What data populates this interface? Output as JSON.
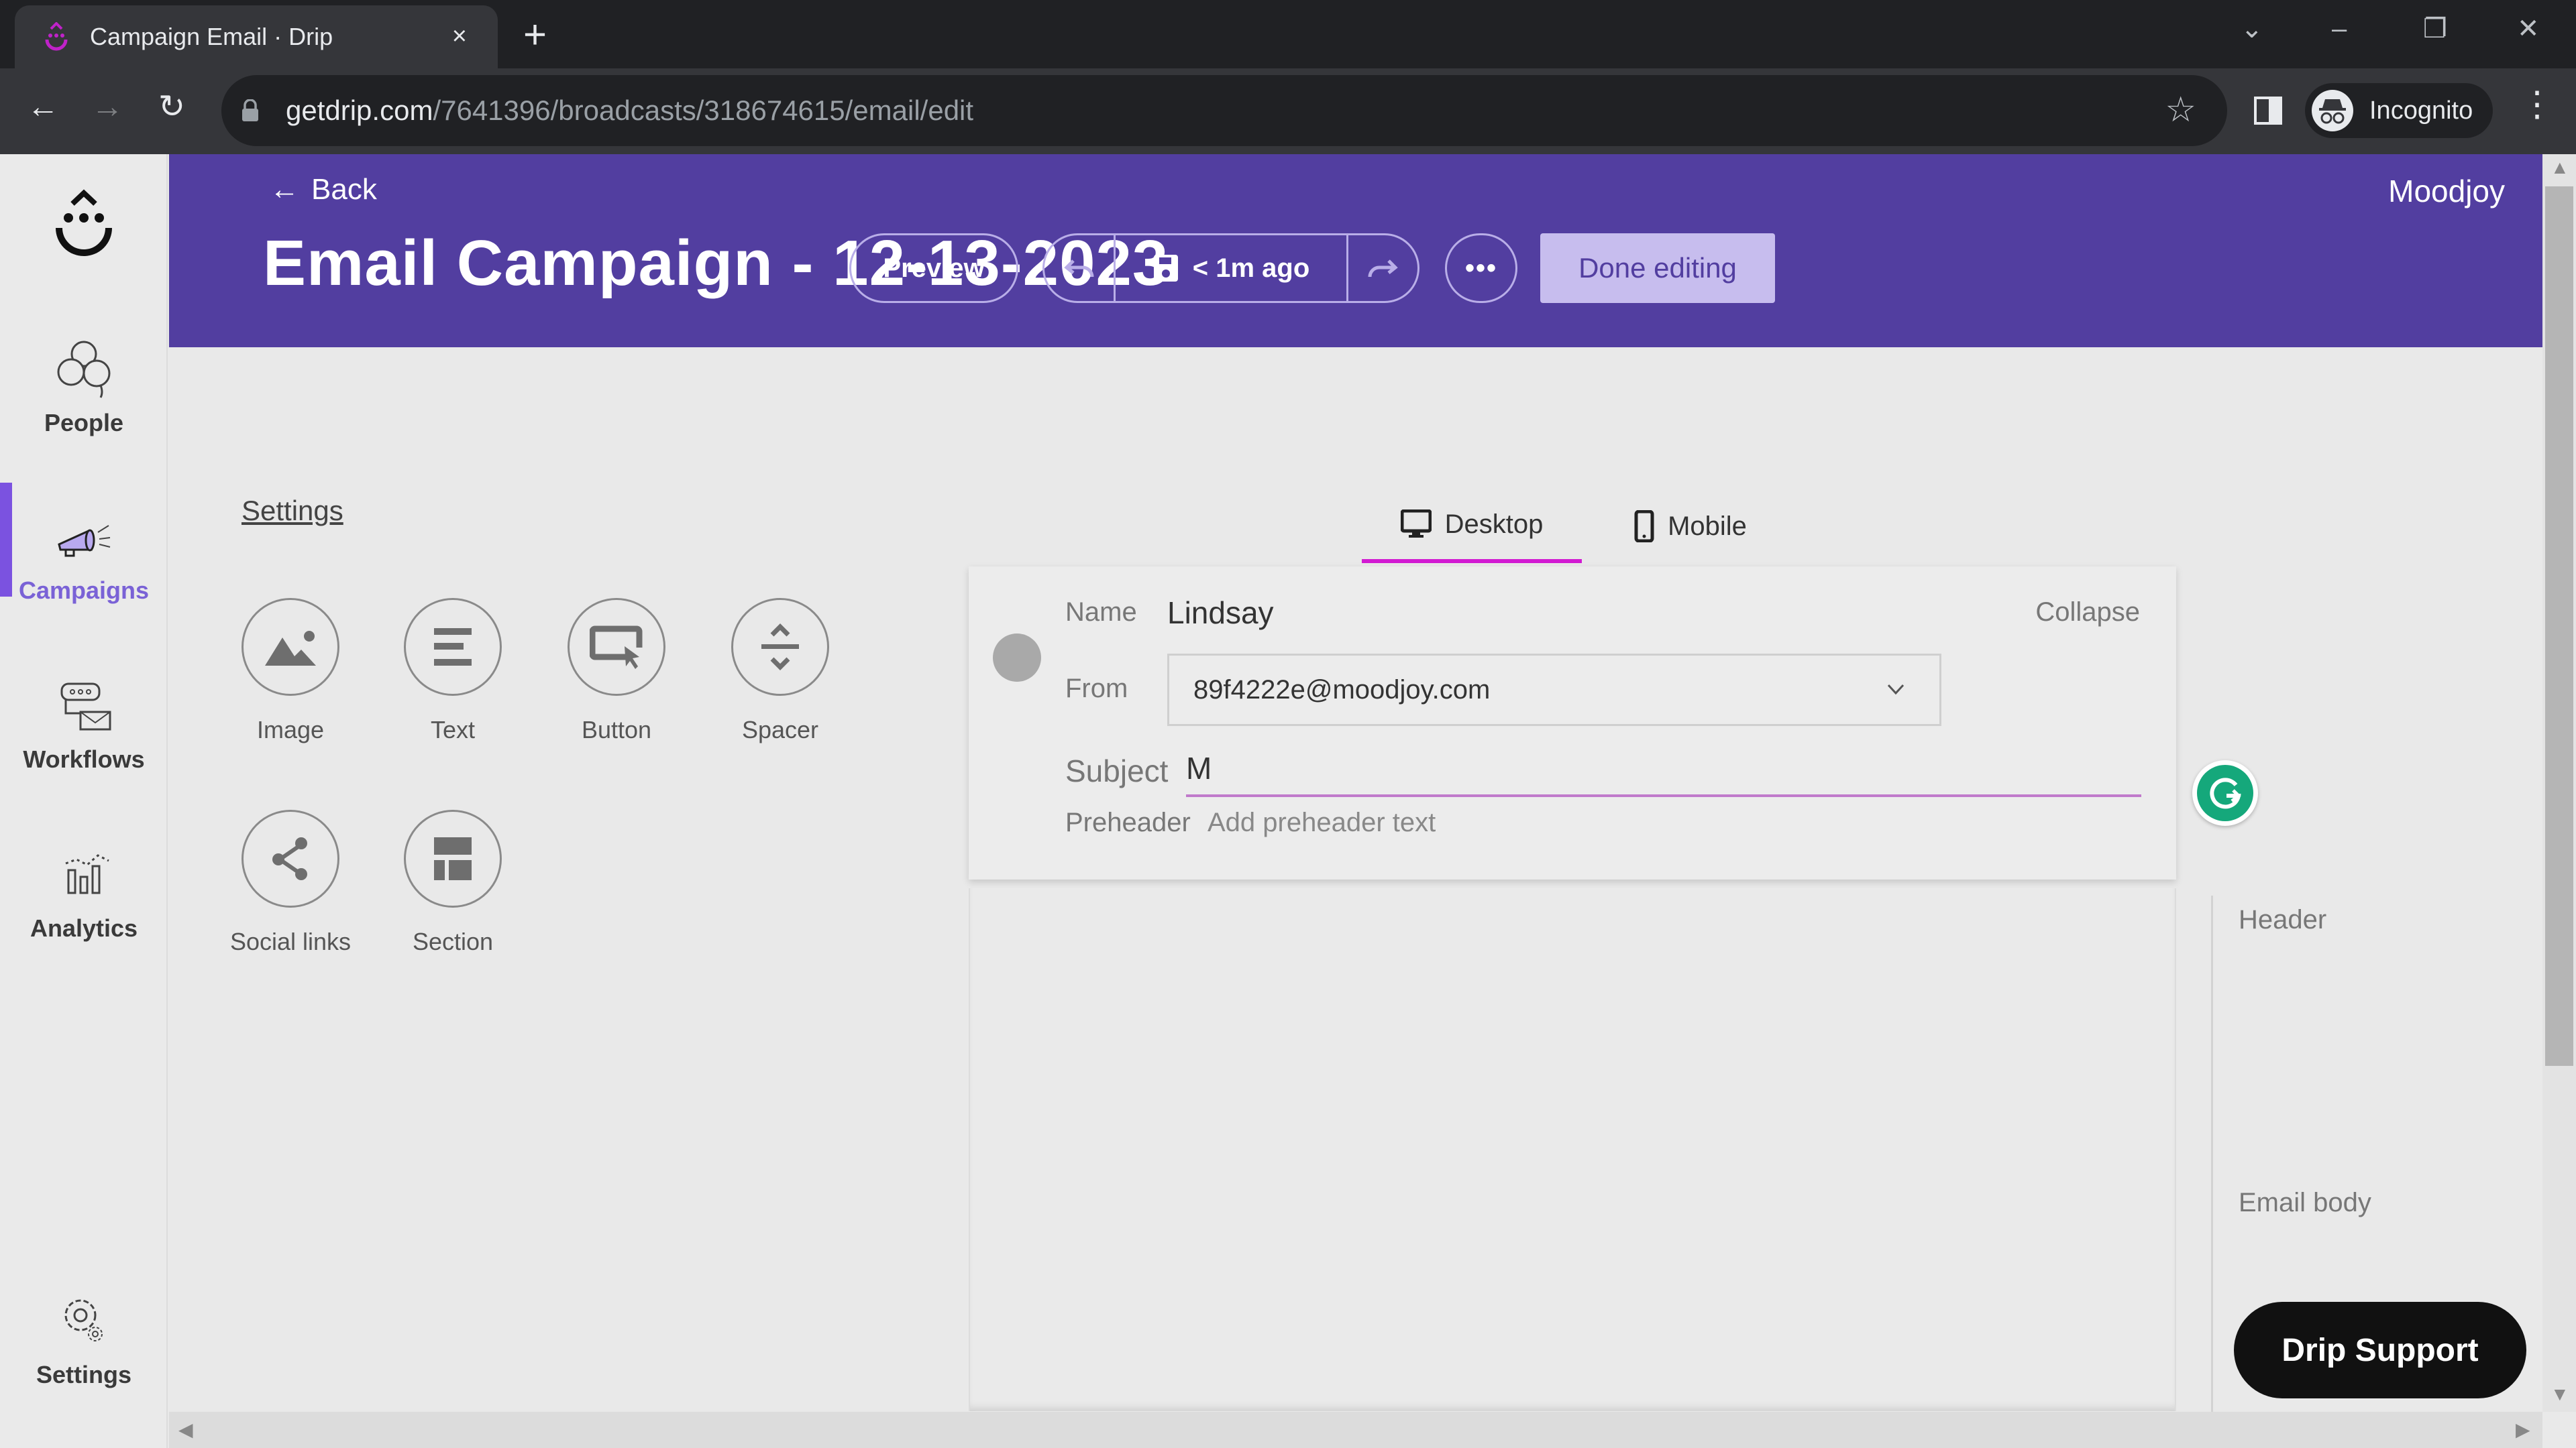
{
  "browser": {
    "tab_title": "Campaign Email · Drip",
    "close_tab": "×",
    "new_tab": "+",
    "url_host": "getdrip.com",
    "url_path": "/7641396/broadcasts/318674615/email/edit",
    "profile_label": "Incognito",
    "window_controls": {
      "tab_search": "⌄",
      "minimize": "–",
      "restore": "❐",
      "close": "✕"
    },
    "nav": {
      "back": "←",
      "forward": "→",
      "reload": "↻"
    },
    "menu_icon": "⋮",
    "star_icon": "☆"
  },
  "sidebar": {
    "items": [
      {
        "label": "People",
        "icon": "people-icon"
      },
      {
        "label": "Campaigns",
        "icon": "megaphone-icon",
        "active": true
      },
      {
        "label": "Workflows",
        "icon": "workflow-icon"
      },
      {
        "label": "Analytics",
        "icon": "analytics-icon"
      },
      {
        "label": "Settings",
        "icon": "gear-icon"
      }
    ]
  },
  "header": {
    "back_label": "Back",
    "title": "Email Campaign - 12-13-2023",
    "account": "Moodjoy",
    "preview_label": "Preview",
    "saved_status": "< 1m ago",
    "more_label": "•••",
    "done_label": "Done editing",
    "colors": {
      "header_bg": "#523ea0",
      "done_bg": "#c7bdee"
    }
  },
  "editor": {
    "settings_link": "Settings",
    "elements": [
      {
        "label": "Image",
        "icon": "image-icon"
      },
      {
        "label": "Text",
        "icon": "text-icon"
      },
      {
        "label": "Button",
        "icon": "button-icon"
      },
      {
        "label": "Spacer",
        "icon": "spacer-icon"
      },
      {
        "label": "Social links",
        "icon": "share-icon"
      },
      {
        "label": "Section",
        "icon": "section-icon"
      }
    ],
    "view_tabs": [
      {
        "label": "Desktop",
        "active": true
      },
      {
        "label": "Mobile",
        "active": false
      }
    ],
    "envelope": {
      "name_label": "Name",
      "name_value": "Lindsay",
      "collapse_label": "Collapse",
      "from_label": "From",
      "from_value": "89f4222e@moodjoy.com",
      "subject_label": "Subject",
      "subject_value": "M",
      "preheader_label": "Preheader",
      "preheader_placeholder": "Add preheader text"
    },
    "outline": {
      "items": [
        "Header",
        "Email body"
      ]
    },
    "support_label": "Drip Support",
    "accent_color": "#d21ad2"
  }
}
